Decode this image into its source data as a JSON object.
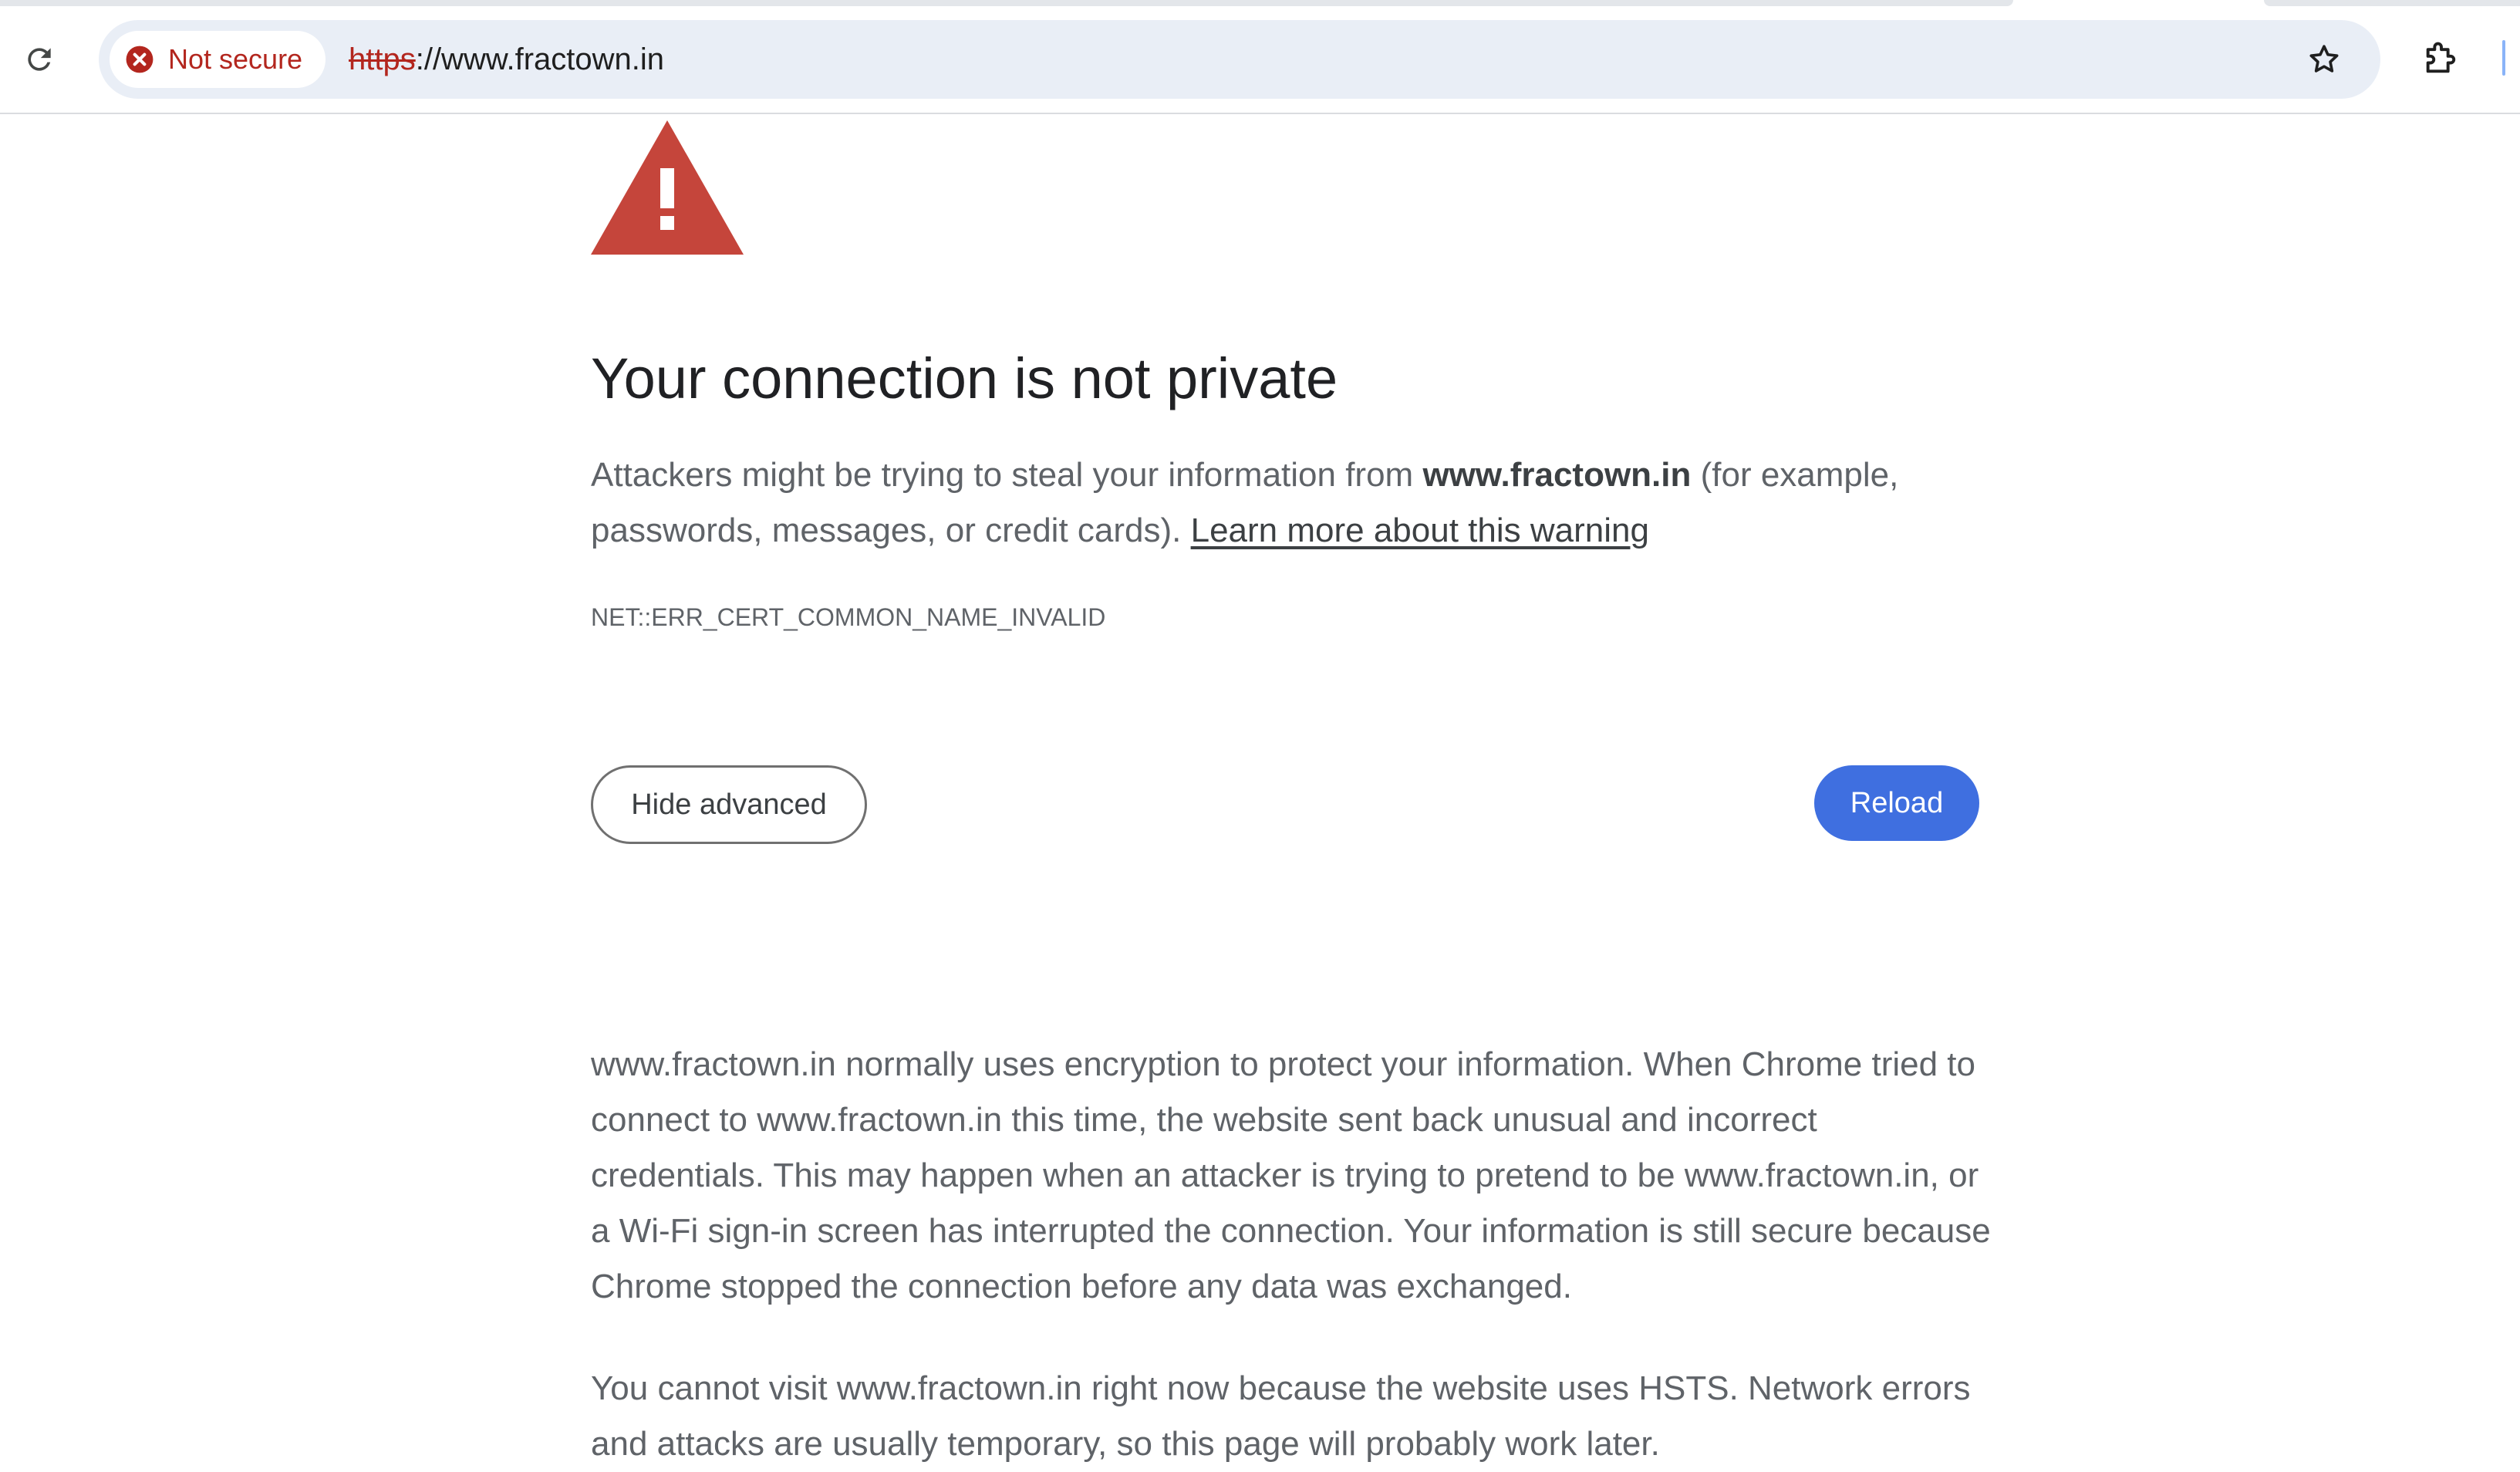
{
  "browser": {
    "security_chip_label": "Not secure",
    "url_scheme": "https",
    "url_rest": "://www.fractown.in",
    "icons": {
      "reload": "reload-icon",
      "security": "error-circle-icon",
      "bookmark": "star-icon",
      "extensions": "puzzle-icon"
    },
    "colors": {
      "security_red": "#b3261e",
      "omnibox_bg": "#e9eef6"
    }
  },
  "page": {
    "icon": "warning-triangle-icon",
    "heading": "Your connection is not private",
    "intro_before": "Attackers might be trying to steal your information from ",
    "intro_domain": "www.fractown.in",
    "intro_after": " (for example, passwords, messages, or credit cards). ",
    "learn_more_link": "Learn more about this warning",
    "error_code": "NET::ERR_CERT_COMMON_NAME_INVALID",
    "hide_advanced_button": "Hide advanced",
    "reload_button": "Reload",
    "details_text": "www.fractown.in normally uses encryption to protect your information. When Chrome tried to connect to www.fractown.in this time, the website sent back unusual and incorrect credentials. This may happen when an attacker is trying to pretend to be www.fractown.in, or a Wi-Fi sign-in screen has interrupted the connection. Your information is still secure because Chrome stopped the connection before any data was exchanged.",
    "hsts_text": "You cannot visit www.fractown.in right now because the website uses HSTS. Network errors and attacks are usually temporary, so this page will probably work later.",
    "colors": {
      "warning_red": "#c5453b",
      "primary_button": "#3f6fe0"
    }
  }
}
